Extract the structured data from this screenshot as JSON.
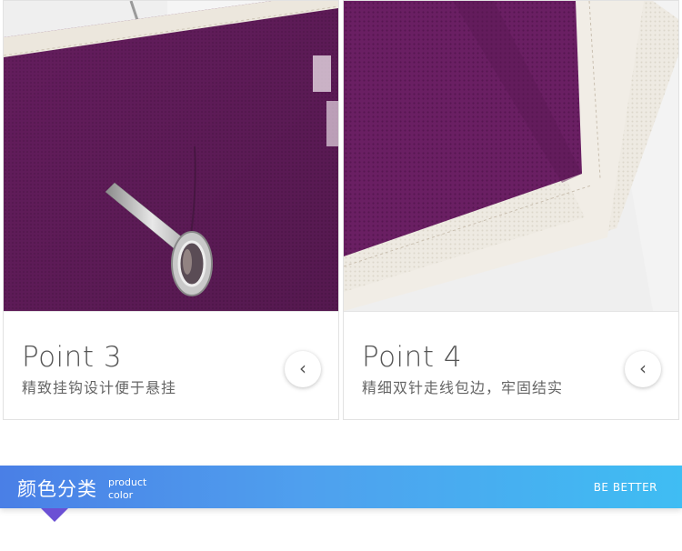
{
  "cards": [
    {
      "title": "Point 3",
      "description": "精致挂钩设计便于悬挂",
      "arrow": "‹",
      "image_icon": "purple-fabric-hook-photo"
    },
    {
      "title": "Point 4",
      "description": "精细双针走线包边，牢固结实",
      "arrow": "‹",
      "image_icon": "purple-fabric-stitched-edge-photo"
    }
  ],
  "banner": {
    "title": "颜色分类",
    "subtitle_line1": "product",
    "subtitle_line2": "color",
    "right_text": "BE BETTER"
  },
  "colors": {
    "fabric_purple": "#6a1f63",
    "banner_start": "#4a7fe6",
    "banner_end": "#3fbdf3",
    "pointer": "#6b50d4"
  }
}
